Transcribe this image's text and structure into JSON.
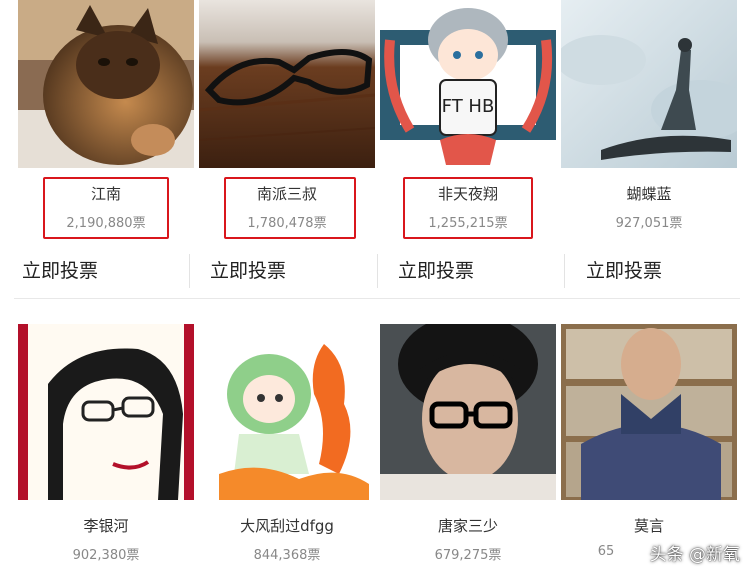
{
  "row1": [
    {
      "name": "江南",
      "votes": "2,190,880票"
    },
    {
      "name": "南派三叔",
      "votes": "1,780,478票"
    },
    {
      "name": "非天夜翔",
      "votes": "1,255,215票"
    },
    {
      "name": "蝴蝶蓝",
      "votes": "927,051票"
    }
  ],
  "vote_label": "立即投票",
  "row2": [
    {
      "name": "李银河",
      "votes": "902,380票"
    },
    {
      "name": "大风刮过dfgg",
      "votes": "844,368票"
    },
    {
      "name": "唐家三少",
      "votes": "679,275票"
    },
    {
      "name": "莫言",
      "votes": "65"
    }
  ],
  "avatar_text": "FT HB",
  "watermark": "头条 @新氧",
  "colors": {
    "highlight": "#d9161c"
  }
}
